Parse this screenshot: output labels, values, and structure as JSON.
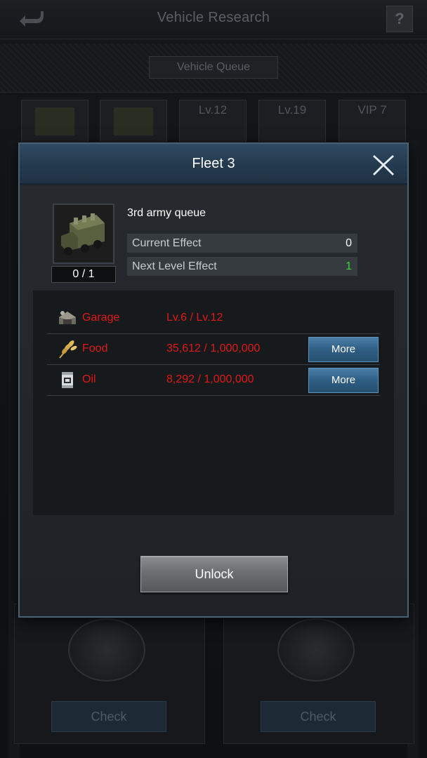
{
  "background": {
    "title": "Vehicle Research",
    "queue_label": "Vehicle Queue",
    "slots": [
      "",
      "",
      "Lv.12",
      "Lv.19",
      "VIP 7"
    ],
    "check_left": "Check",
    "check_right": "Check"
  },
  "modal": {
    "title": "Fleet 3",
    "item_count": "0 / 1",
    "queue_name": "3rd army queue",
    "current_effect_label": "Current Effect",
    "current_effect_value": "0",
    "next_effect_label": "Next Level Effect",
    "next_effect_value": "1",
    "requirements": [
      {
        "icon": "garage-icon",
        "name": "Garage",
        "value": "Lv.6 / Lv.12",
        "button": ""
      },
      {
        "icon": "wheat-icon",
        "name": "Food",
        "value": "35,612 / 1,000,000",
        "button": "More"
      },
      {
        "icon": "oil-can-icon",
        "name": "Oil",
        "value": "8,292 / 1,000,000",
        "button": "More"
      }
    ],
    "unlock_label": "Unlock"
  },
  "colors": {
    "requirement_unmet": "#e01818",
    "next_effect": "#3cd63c",
    "header_blue": "#2f4a61",
    "more_button": "#2f5e84"
  }
}
